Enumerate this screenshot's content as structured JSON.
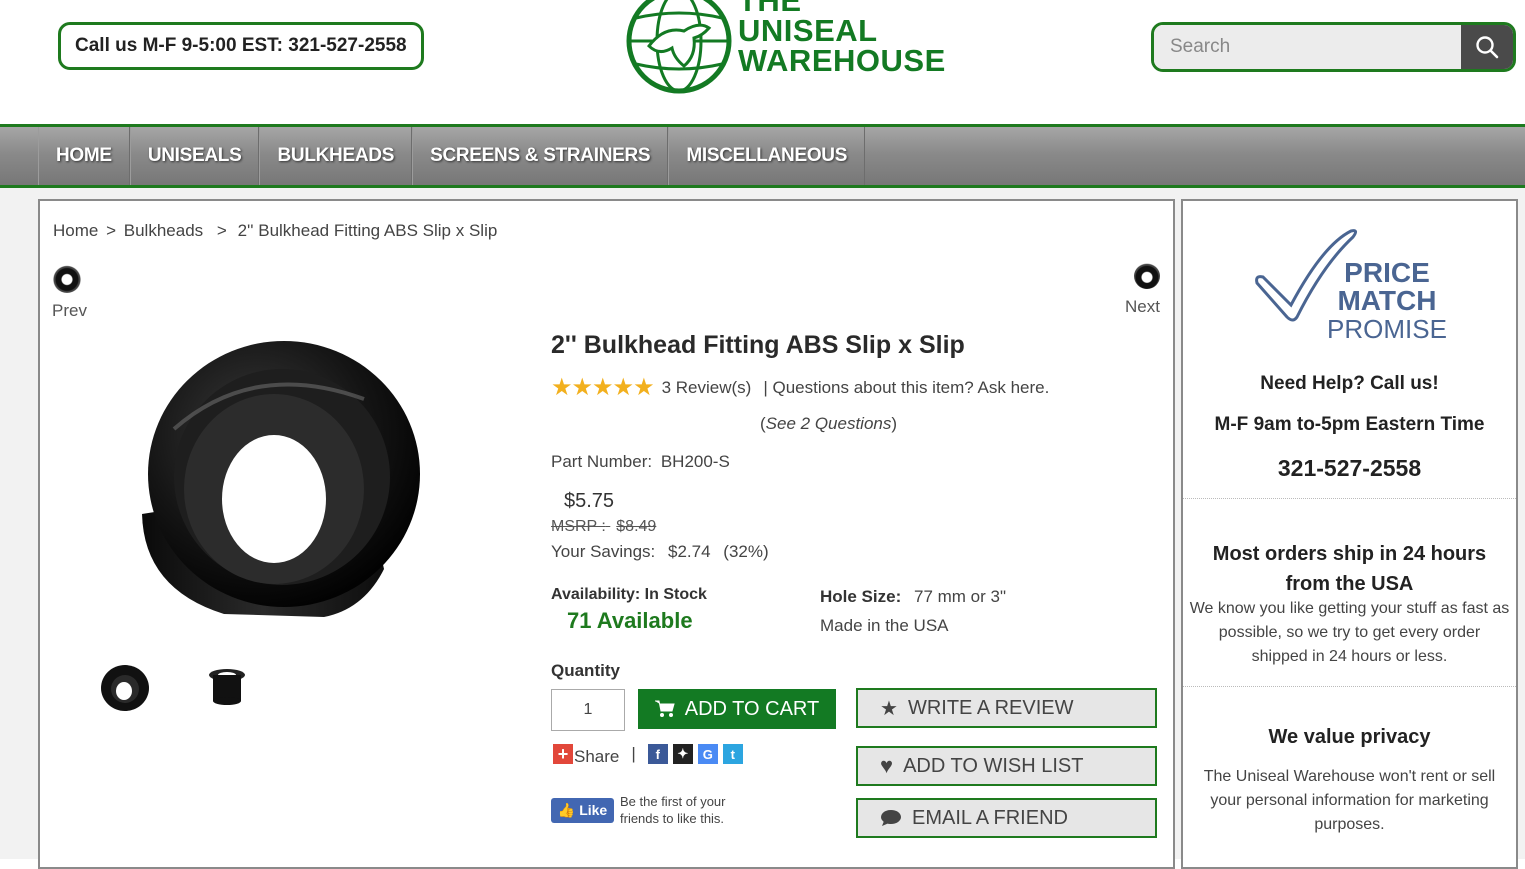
{
  "header": {
    "call_text": "Call us M-F 9-5:00 EST: 321-527-2558",
    "logo_lines": [
      "THE",
      "UNISEAL",
      "WAREHOUSE"
    ],
    "search_placeholder": "Search"
  },
  "nav": {
    "items": [
      "HOME",
      "UNISEALS",
      "BULKHEADS",
      "SCREENS & STRAINERS",
      "MISCELLANEOUS"
    ]
  },
  "breadcrumb": {
    "home": "Home",
    "sep1": ">",
    "category": "Bulkheads",
    "sep2": ">",
    "current": "2'' Bulkhead Fitting ABS Slip x Slip"
  },
  "pager": {
    "prev": "Prev",
    "next": "Next"
  },
  "product": {
    "title": "2'' Bulkhead Fitting ABS Slip x Slip",
    "stars": "★★★★★",
    "rating": 5,
    "reviews": "3 Review(s)",
    "questions_link": "| Questions about this item? Ask here.",
    "see_questions_open": "(",
    "see_questions": "See 2 Questions",
    "see_questions_close": ")",
    "part_label": "Part Number:",
    "part_number": "BH200-S",
    "price": "$5.75",
    "msrp_label": "MSRP :",
    "msrp": "$8.49",
    "savings_label": "Your Savings:",
    "savings": "$2.74",
    "savings_pct": "(32%)",
    "availability_label": "Availability:",
    "availability_value": "In Stock",
    "available_count": "71 Available",
    "hole_label": "Hole Size:",
    "hole_value": "77 mm or 3\"",
    "made_in": "Made in the USA",
    "quantity_label": "Quantity",
    "quantity_value": "1",
    "add_to_cart": "ADD TO CART",
    "write_review": "WRITE A REVIEW",
    "add_wishlist": "ADD TO WISH LIST",
    "email_friend": "EMAIL A FRIEND",
    "share_label": "Share",
    "share_sep": "|",
    "like_label": "Like",
    "like_text_1": "Be the first of your",
    "like_text_2": "friends to like this."
  },
  "sidebar": {
    "pm_line1": "PRICE",
    "pm_line2": "MATCH",
    "pm_line3": "PROMISE",
    "help_heading": "Need Help? Call us!",
    "hours": "M-F 9am to-5pm Eastern Time",
    "phone": "321-527-2558",
    "ship_heading_1": "Most orders ship in 24 hours",
    "ship_heading_2": "from the USA",
    "ship_text": "We know you like getting your stuff as fast as possible, so we try to get every order shipped in 24 hours or less.",
    "privacy_heading": "We value privacy",
    "privacy_text": "The Uniseal Warehouse won't rent or sell your personal information for marketing purposes."
  },
  "colors": {
    "brand_green": "#137a23",
    "star_gold": "#f2b01e",
    "nav_gray": "#8a8a8a",
    "price_match_blue": "#4a6592"
  }
}
